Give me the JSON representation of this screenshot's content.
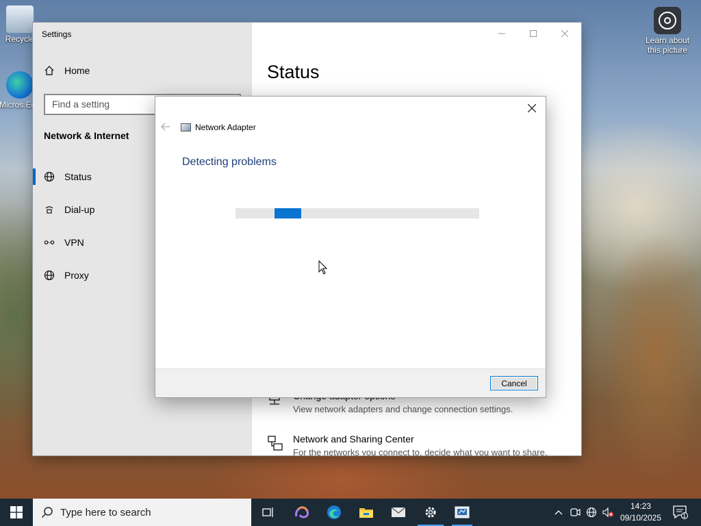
{
  "desktop": {
    "recycle_label": "Recycle",
    "edge_label": "Micros Edg",
    "learn_label": "Learn about this picture"
  },
  "settings": {
    "window_title": "Settings",
    "home_label": "Home",
    "search_placeholder": "Find a setting",
    "section_heading": "Network & Internet",
    "nav": [
      {
        "label": "Status",
        "icon": "globe-icon",
        "active": true
      },
      {
        "label": "Dial-up",
        "icon": "dialup-icon",
        "active": false
      },
      {
        "label": "VPN",
        "icon": "vpn-icon",
        "active": false
      },
      {
        "label": "Proxy",
        "icon": "globe-icon",
        "active": false
      }
    ],
    "page_title": "Status",
    "links": [
      {
        "title": "Change adapter options",
        "desc": "View network adapters and change connection settings."
      },
      {
        "title": "Network and Sharing Center",
        "desc": "For the networks you connect to, decide what you want to share."
      }
    ]
  },
  "troubleshooter": {
    "title": "Network Adapter",
    "heading": "Detecting problems",
    "progress": "indeterminate",
    "cancel_label": "Cancel"
  },
  "taskbar": {
    "search_placeholder": "Type here to search",
    "apps": [
      "task-view-icon",
      "copilot-icon",
      "edge-icon",
      "file-explorer-icon",
      "mail-icon",
      "settings-icon",
      "troubleshooter-icon"
    ],
    "time": "14:23",
    "date": "09/10/2025",
    "notification_count": "1"
  },
  "colors": {
    "accent": "#0067c0",
    "progress": "#0a74d1",
    "heading_blue": "#1e3e7a",
    "taskbar": "#1c2a35"
  }
}
